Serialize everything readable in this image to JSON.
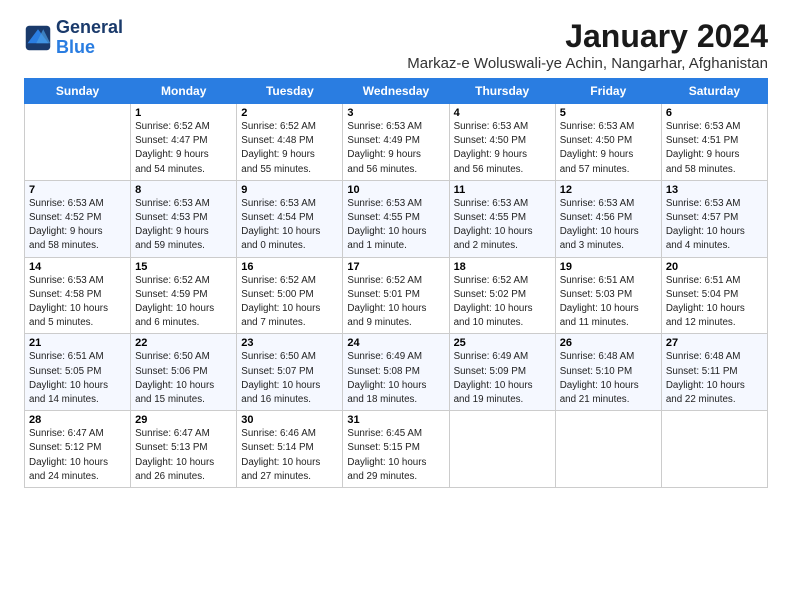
{
  "logo": {
    "line1": "General",
    "line2": "Blue"
  },
  "title": "January 2024",
  "subtitle": "Markaz-e Woluswali-ye Achin, Nangarhar, Afghanistan",
  "days_header": [
    "Sunday",
    "Monday",
    "Tuesday",
    "Wednesday",
    "Thursday",
    "Friday",
    "Saturday"
  ],
  "weeks": [
    [
      {
        "day": "",
        "info": ""
      },
      {
        "day": "1",
        "info": "Sunrise: 6:52 AM\nSunset: 4:47 PM\nDaylight: 9 hours\nand 54 minutes."
      },
      {
        "day": "2",
        "info": "Sunrise: 6:52 AM\nSunset: 4:48 PM\nDaylight: 9 hours\nand 55 minutes."
      },
      {
        "day": "3",
        "info": "Sunrise: 6:53 AM\nSunset: 4:49 PM\nDaylight: 9 hours\nand 56 minutes."
      },
      {
        "day": "4",
        "info": "Sunrise: 6:53 AM\nSunset: 4:50 PM\nDaylight: 9 hours\nand 56 minutes."
      },
      {
        "day": "5",
        "info": "Sunrise: 6:53 AM\nSunset: 4:50 PM\nDaylight: 9 hours\nand 57 minutes."
      },
      {
        "day": "6",
        "info": "Sunrise: 6:53 AM\nSunset: 4:51 PM\nDaylight: 9 hours\nand 58 minutes."
      }
    ],
    [
      {
        "day": "7",
        "info": "Sunrise: 6:53 AM\nSunset: 4:52 PM\nDaylight: 9 hours\nand 58 minutes."
      },
      {
        "day": "8",
        "info": "Sunrise: 6:53 AM\nSunset: 4:53 PM\nDaylight: 9 hours\nand 59 minutes."
      },
      {
        "day": "9",
        "info": "Sunrise: 6:53 AM\nSunset: 4:54 PM\nDaylight: 10 hours\nand 0 minutes."
      },
      {
        "day": "10",
        "info": "Sunrise: 6:53 AM\nSunset: 4:55 PM\nDaylight: 10 hours\nand 1 minute."
      },
      {
        "day": "11",
        "info": "Sunrise: 6:53 AM\nSunset: 4:55 PM\nDaylight: 10 hours\nand 2 minutes."
      },
      {
        "day": "12",
        "info": "Sunrise: 6:53 AM\nSunset: 4:56 PM\nDaylight: 10 hours\nand 3 minutes."
      },
      {
        "day": "13",
        "info": "Sunrise: 6:53 AM\nSunset: 4:57 PM\nDaylight: 10 hours\nand 4 minutes."
      }
    ],
    [
      {
        "day": "14",
        "info": "Sunrise: 6:53 AM\nSunset: 4:58 PM\nDaylight: 10 hours\nand 5 minutes."
      },
      {
        "day": "15",
        "info": "Sunrise: 6:52 AM\nSunset: 4:59 PM\nDaylight: 10 hours\nand 6 minutes."
      },
      {
        "day": "16",
        "info": "Sunrise: 6:52 AM\nSunset: 5:00 PM\nDaylight: 10 hours\nand 7 minutes."
      },
      {
        "day": "17",
        "info": "Sunrise: 6:52 AM\nSunset: 5:01 PM\nDaylight: 10 hours\nand 9 minutes."
      },
      {
        "day": "18",
        "info": "Sunrise: 6:52 AM\nSunset: 5:02 PM\nDaylight: 10 hours\nand 10 minutes."
      },
      {
        "day": "19",
        "info": "Sunrise: 6:51 AM\nSunset: 5:03 PM\nDaylight: 10 hours\nand 11 minutes."
      },
      {
        "day": "20",
        "info": "Sunrise: 6:51 AM\nSunset: 5:04 PM\nDaylight: 10 hours\nand 12 minutes."
      }
    ],
    [
      {
        "day": "21",
        "info": "Sunrise: 6:51 AM\nSunset: 5:05 PM\nDaylight: 10 hours\nand 14 minutes."
      },
      {
        "day": "22",
        "info": "Sunrise: 6:50 AM\nSunset: 5:06 PM\nDaylight: 10 hours\nand 15 minutes."
      },
      {
        "day": "23",
        "info": "Sunrise: 6:50 AM\nSunset: 5:07 PM\nDaylight: 10 hours\nand 16 minutes."
      },
      {
        "day": "24",
        "info": "Sunrise: 6:49 AM\nSunset: 5:08 PM\nDaylight: 10 hours\nand 18 minutes."
      },
      {
        "day": "25",
        "info": "Sunrise: 6:49 AM\nSunset: 5:09 PM\nDaylight: 10 hours\nand 19 minutes."
      },
      {
        "day": "26",
        "info": "Sunrise: 6:48 AM\nSunset: 5:10 PM\nDaylight: 10 hours\nand 21 minutes."
      },
      {
        "day": "27",
        "info": "Sunrise: 6:48 AM\nSunset: 5:11 PM\nDaylight: 10 hours\nand 22 minutes."
      }
    ],
    [
      {
        "day": "28",
        "info": "Sunrise: 6:47 AM\nSunset: 5:12 PM\nDaylight: 10 hours\nand 24 minutes."
      },
      {
        "day": "29",
        "info": "Sunrise: 6:47 AM\nSunset: 5:13 PM\nDaylight: 10 hours\nand 26 minutes."
      },
      {
        "day": "30",
        "info": "Sunrise: 6:46 AM\nSunset: 5:14 PM\nDaylight: 10 hours\nand 27 minutes."
      },
      {
        "day": "31",
        "info": "Sunrise: 6:45 AM\nSunset: 5:15 PM\nDaylight: 10 hours\nand 29 minutes."
      },
      {
        "day": "",
        "info": ""
      },
      {
        "day": "",
        "info": ""
      },
      {
        "day": "",
        "info": ""
      }
    ]
  ]
}
